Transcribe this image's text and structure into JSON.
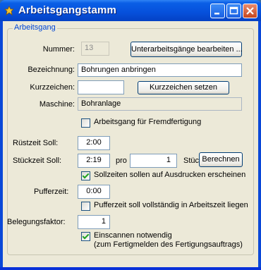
{
  "window": {
    "title": "Arbeitsgangstamm"
  },
  "group": {
    "label": "Arbeitsgang"
  },
  "nummer": {
    "label": "Nummer:",
    "value": "13"
  },
  "unterarbeitsgaenge_button": "Unterarbeitsgänge bearbeiten ...",
  "bezeichnung": {
    "label": "Bezeichnung:",
    "value": "Bohrungen anbringen"
  },
  "kurzzeichen": {
    "label": "Kurzzeichen:",
    "value": "",
    "button": "Kurzzeichen setzen"
  },
  "maschine": {
    "label": "Maschine:",
    "value": "Bohranlage"
  },
  "fremdfertigung": {
    "label": "Arbeitsgang für Fremdfertigung",
    "checked": false
  },
  "ruestzeit": {
    "label": "Rüstzeit Soll:",
    "value": "2:00"
  },
  "stueckzeit": {
    "label": "Stückzeit Soll:",
    "value": "2:19",
    "pro_label": "pro",
    "qty": "1",
    "unit_label": "Stück",
    "button": "Berechnen"
  },
  "sollzeiten_drucken": {
    "label": "Sollzeiten sollen auf Ausdrucken erscheinen",
    "checked": true
  },
  "pufferzeit": {
    "label": "Pufferzeit:",
    "value": "0:00"
  },
  "puffer_arbeitszeit": {
    "label": "Pufferzeit soll vollständig in Arbeitszeit liegen",
    "checked": false
  },
  "belegungsfaktor": {
    "label": "Belegungsfaktor:",
    "value": "1"
  },
  "einscannen": {
    "label_line1": "Einscannen notwendig",
    "label_line2": "(zum Fertigmelden des Fertigungsauftrags)",
    "checked": true
  },
  "colors": {
    "titlebar": "#0650db",
    "client": "#ece9d8",
    "group_label": "#0046d5"
  }
}
